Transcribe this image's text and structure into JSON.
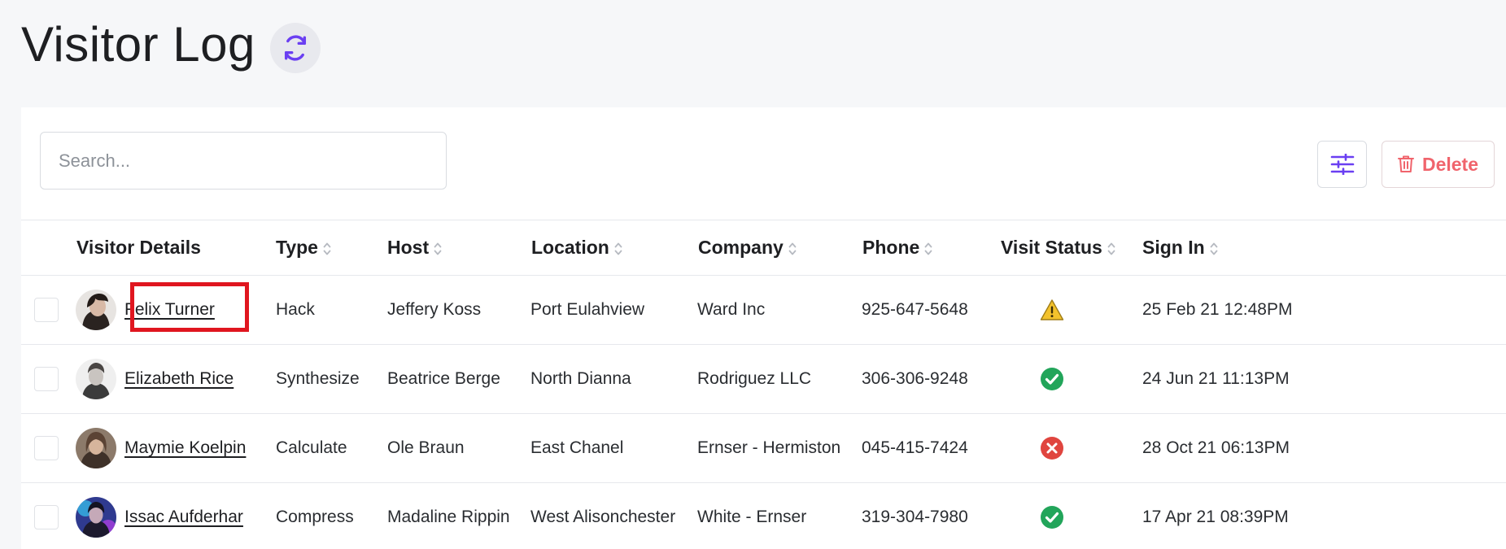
{
  "page": {
    "title": "Visitor Log",
    "refresh_icon": "refresh-icon"
  },
  "toolbar": {
    "search_placeholder": "Search...",
    "search_value": "",
    "filter_icon": "sliders-icon",
    "delete_label": "Delete",
    "delete_icon": "trash-icon"
  },
  "table": {
    "headers": {
      "visitor": "Visitor Details",
      "type": "Type",
      "host": "Host",
      "location": "Location",
      "company": "Company",
      "phone": "Phone",
      "status": "Visit Status",
      "sign_in": "Sign In"
    },
    "rows": [
      {
        "name": "Felix Turner",
        "type": "Hack",
        "host": "Jeffery Koss",
        "location": "Port Eulahview",
        "company": "Ward Inc",
        "phone": "925-647-5648",
        "status": "warning",
        "sign_in": "25 Feb 21 12:48PM"
      },
      {
        "name": "Elizabeth Rice",
        "type": "Synthesize",
        "host": "Beatrice Berge",
        "location": "North Dianna",
        "company": "Rodriguez LLC",
        "phone": "306-306-9248",
        "status": "success",
        "sign_in": "24 Jun 21 11:13PM"
      },
      {
        "name": "Maymie Koelpin",
        "type": "Calculate",
        "host": "Ole Braun",
        "location": "East Chanel",
        "company": "Ernser - Hermiston",
        "phone": "045-415-7424",
        "status": "error",
        "sign_in": "28 Oct 21 06:13PM"
      },
      {
        "name": "Issac Aufderhar",
        "type": "Compress",
        "host": "Madaline Rippin",
        "location": "West Alisonchester",
        "company": "White - Ernser",
        "phone": "319-304-7980",
        "status": "success",
        "sign_in": "17 Apr 21 08:39PM"
      }
    ]
  },
  "colors": {
    "accent": "#6a3ff2",
    "danger": "#f0646c",
    "success": "#22a55a",
    "error": "#e0453f",
    "warning": "#f3c22c",
    "highlight": "#e0161f"
  }
}
